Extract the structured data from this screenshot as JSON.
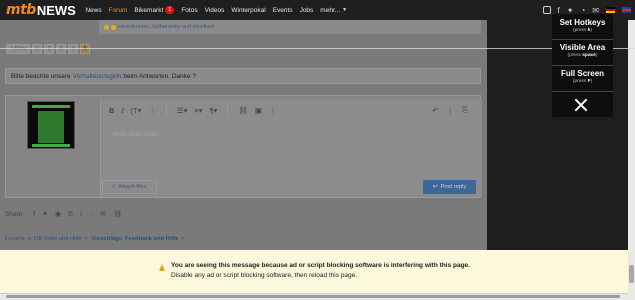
{
  "header": {
    "logo_mtb": "mtb",
    "logo_news": "NEWS",
    "nav": [
      {
        "label": "News"
      },
      {
        "label": "Forum",
        "active": true
      },
      {
        "label": "Bikemarkt",
        "badge": "1"
      },
      {
        "label": "Fotos"
      },
      {
        "label": "Videos"
      },
      {
        "label": "Winterpokal"
      },
      {
        "label": "Events"
      },
      {
        "label": "Jobs"
      },
      {
        "label": "mehr..."
      }
    ],
    "icons": [
      "instagram-icon",
      "facebook-icon",
      "twitter-icon",
      "rss-icon",
      "mail-icon",
      "flag-de-icon",
      "flag-uk-icon"
    ]
  },
  "reactions": {
    "text": "inkredimmer, Jabberwoky and slowfreet"
  },
  "pagination": {
    "prev": "< Prev",
    "pages": [
      "1",
      "2",
      "3",
      "4",
      "5"
    ],
    "current": "5"
  },
  "notice": {
    "before": "Bitte beachte unsere",
    "link": "Verhaltensregeln",
    "after": "beim Antworten. Danke ?"
  },
  "editor": {
    "placeholder": "Write your reply...",
    "attach_label": "Attach files",
    "post_label": "Post reply"
  },
  "share": {
    "label": "Share:"
  },
  "breadcrumb": {
    "items": [
      "Forums",
      "Off-Topic und Hilfe",
      "Vorschläge, Feedback und Hilfe"
    ]
  },
  "banner": {
    "line1": "You are seeing this message because ad or script blocking software is interfering with this page.",
    "line2": "Disable any ad or script blocking software, then reload this page."
  },
  "hotkeys": {
    "set_title": "Set Hotkeys",
    "set_hint_pre": "(press",
    "set_key": "k",
    "set_hint_post": ")",
    "area_title": "Visible Area",
    "area_hint_pre": "(press",
    "area_key": "space",
    "area_hint_post": ")",
    "full_title": "Full Screen",
    "full_hint_pre": "(press",
    "full_key": "F",
    "full_hint_post": ")"
  },
  "colors": {
    "brand": "#f08a1c",
    "nav_bg": "#1f1f1f",
    "banner_bg": "#fbf8dc",
    "post_button": "#3e6797"
  }
}
